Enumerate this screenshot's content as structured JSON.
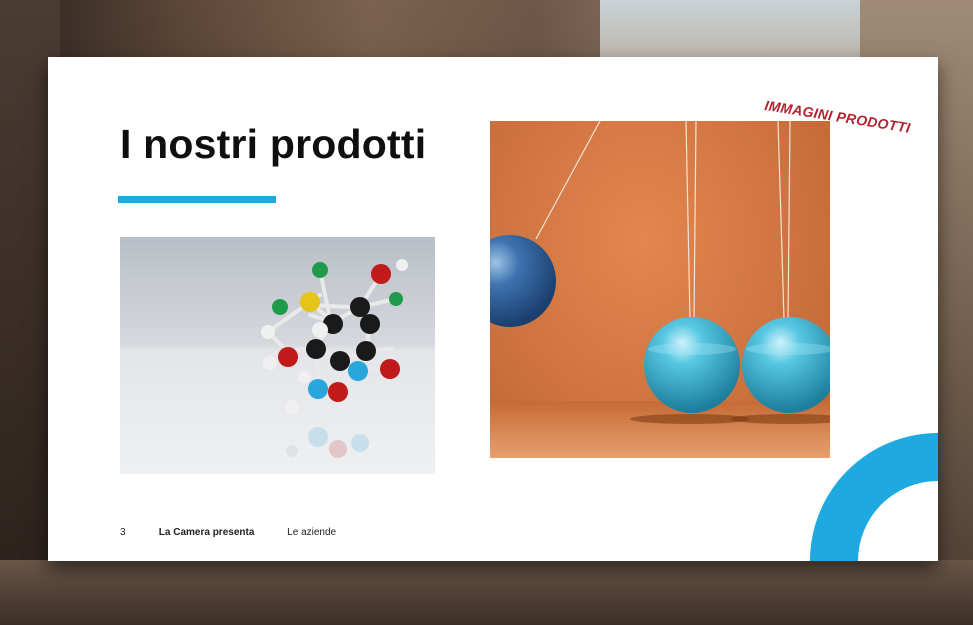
{
  "slide": {
    "title": "I nostri prodotti",
    "corner_label": "IMMAGINI PRODOTTI",
    "accent_color": "#1ea9e1",
    "label_color": "#b3232f"
  },
  "images": {
    "left": "molecule-model-image",
    "right": "newtons-cradle-image"
  },
  "footer": {
    "page_number": "3",
    "presenter": "La Camera presenta",
    "section": "Le aziende"
  }
}
